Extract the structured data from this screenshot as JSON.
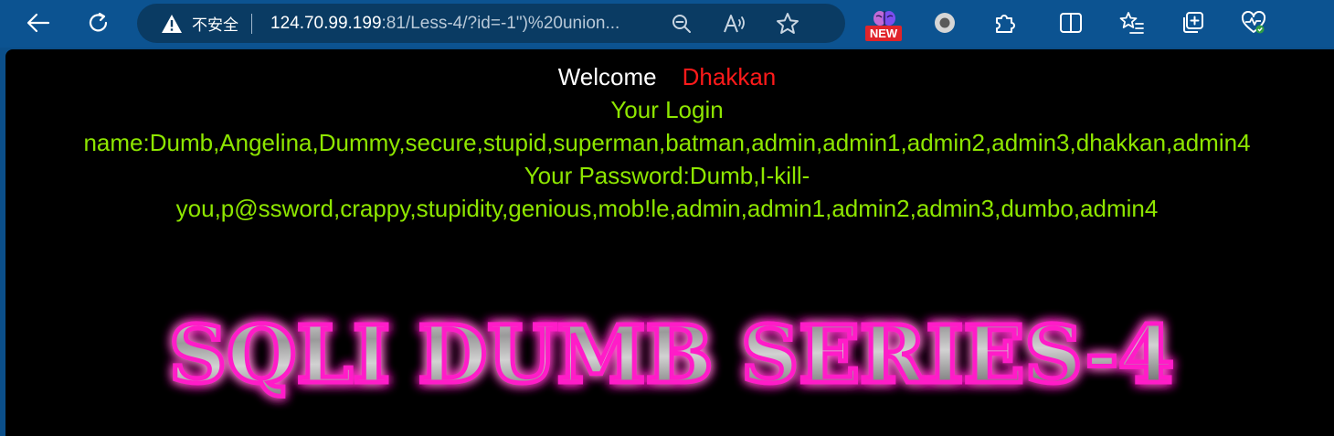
{
  "browser": {
    "security_label": "不安全",
    "url_host": "124.70.99.199",
    "url_rest": ":81/Less-4/?id=-1\")%20union...",
    "new_badge": "NEW",
    "icons": {
      "back": "back-arrow-icon",
      "refresh": "refresh-icon",
      "warning": "warning-icon",
      "zoom": "zoom-out-icon",
      "read_aloud": "read-aloud-icon",
      "favorite": "star-icon",
      "copilot": "brain-icon",
      "circle_ext": "circle-extension-icon",
      "extensions": "puzzle-icon",
      "split": "split-screen-icon",
      "favorites": "favorites-list-icon",
      "collections": "collections-icon",
      "health": "heart-pulse-icon"
    }
  },
  "page": {
    "welcome_label": "Welcome",
    "welcome_name": "Dhakkan",
    "login_heading": "Your Login",
    "login_names": "name:Dumb,Angelina,Dummy,secure,stupid,superman,batman,admin,admin1,admin2,admin3,dhakkan,admin4",
    "password_line1": "Your Password:Dumb,I-kill-",
    "password_line2": "you,p@ssword,crappy,stupidity,genious,mob!le,admin,admin1,admin2,admin3,dumbo,admin4",
    "logo_text": "SQLI DUMB SERIES-4"
  },
  "colors": {
    "toolbar": "#0c5391",
    "page_background": "#000000",
    "welcome_name": "#ff1a1a",
    "login_text": "#8ee600",
    "logo_glow": "#ff1fc8"
  }
}
